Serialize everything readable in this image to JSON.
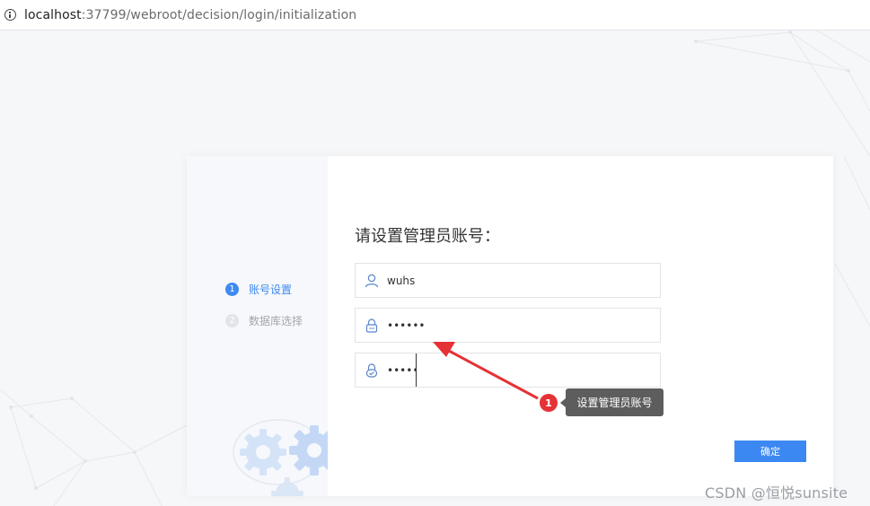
{
  "address_bar": {
    "host": "localhost",
    "path": ":37799/webroot/decision/login/initialization"
  },
  "setup": {
    "steps": [
      {
        "number": "1",
        "label": "账号设置",
        "active": true
      },
      {
        "number": "2",
        "label": "数据库选择",
        "active": false
      }
    ],
    "title": "请设置管理员账号：",
    "username": "wuhs",
    "password": "••••••",
    "confirm_password": "••••••",
    "confirm_button": "确定"
  },
  "annotation": {
    "number": "1",
    "text": "设置管理员账号"
  },
  "watermark": "CSDN @恒悦sunsite",
  "icons": {
    "address": "info-icon",
    "username": "user-icon",
    "password": "lock-icon",
    "confirm": "shield-lock-icon"
  },
  "colors": {
    "accent": "#3c88f2",
    "badge": "#e53236",
    "arrow": "#e53236",
    "tooltip": "#5d5d5d"
  }
}
